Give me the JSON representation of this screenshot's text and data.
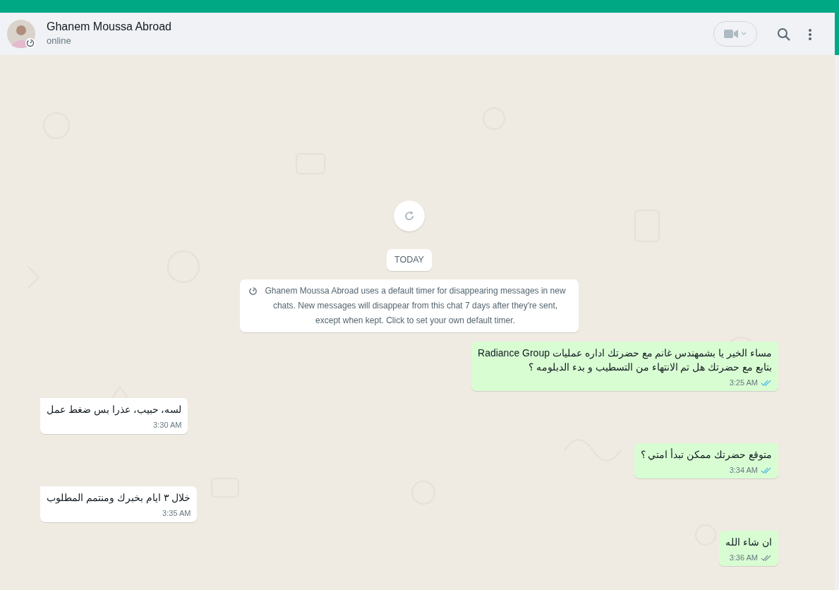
{
  "header": {
    "contact_name": "Ghanem Moussa Abroad",
    "status": "online"
  },
  "today_label": "TODAY",
  "system_notice": "Ghanem Moussa Abroad uses a default timer for disappearing messages in new chats. New messages will disappear from this chat 7 days after they're sent, except when kept. Click to set your own default timer.",
  "messages": [
    {
      "kind": "outgoing",
      "text": "مساء الخير يا بشمهندس غانم مع  حضرتك اداره عمليات Radiance Group\nبتابع مع حضرتك هل تم الانتهاء من التسطيب و بدء الدبلومه ؟",
      "time": "3:25 AM",
      "read": true
    },
    {
      "kind": "incoming",
      "text": "لسه، حبيب، عذرا بس ضغط عمل",
      "time": "3:30 AM"
    },
    {
      "kind": "outgoing",
      "text": "متوقع حضرتك ممكن تبدأ امتي ؟",
      "time": "3:34 AM",
      "read": true
    },
    {
      "kind": "incoming",
      "text": "خلال ٣ ايام بخبرك ومنتمم المطلوب",
      "time": "3:35 AM"
    },
    {
      "kind": "outgoing",
      "text": "ان شاء الله",
      "time": "3:36 AM",
      "read": false
    }
  ]
}
